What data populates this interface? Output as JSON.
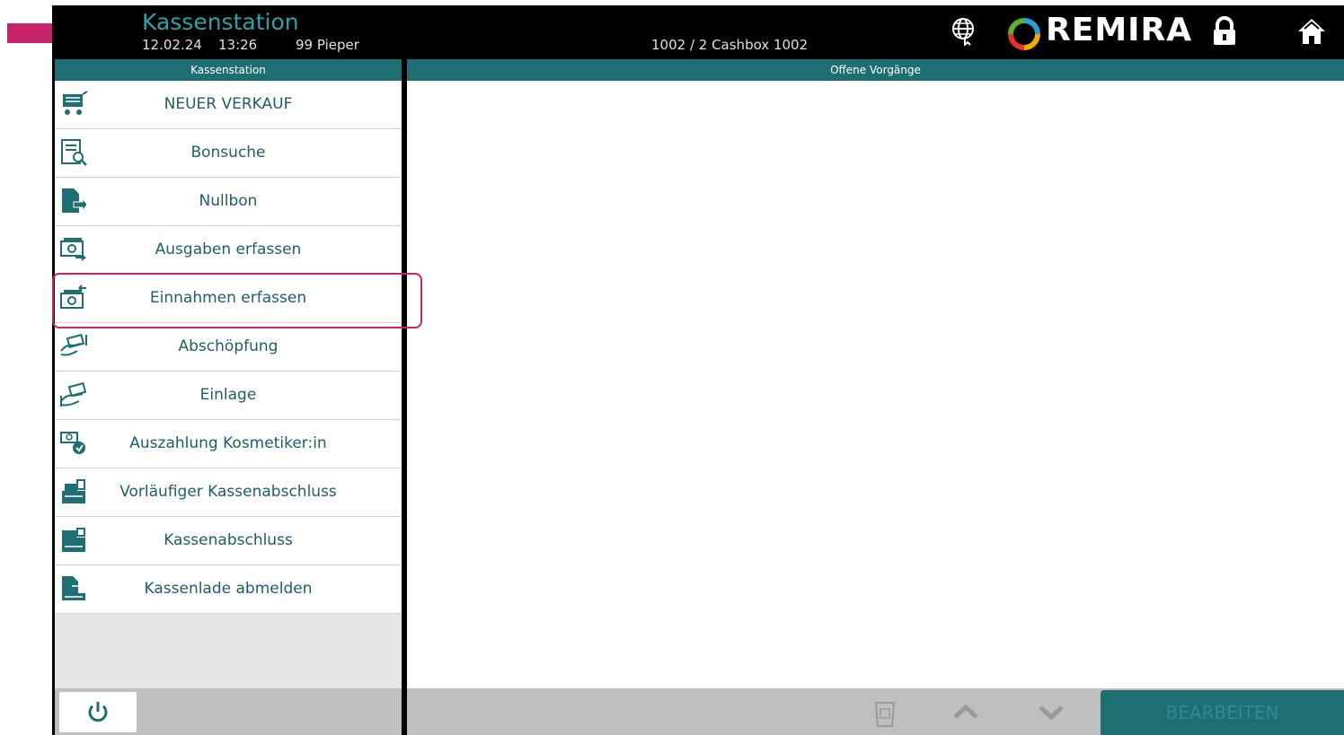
{
  "header": {
    "title": "Kassenstation",
    "date": "12.02.24",
    "time": "13:26",
    "user": "99 Pieper",
    "station": "1002 / 2 Cashbox 1002",
    "brand": "REMIRA",
    "icons": [
      "globe-icon",
      "remira-logo-icon",
      "lock-icon",
      "home-icon"
    ]
  },
  "left_panel": {
    "header": "Kassenstation",
    "items": [
      {
        "label": "NEUER VERKAUF",
        "icon": "cart-icon"
      },
      {
        "label": "Bonsuche",
        "icon": "receipt-search-icon"
      },
      {
        "label": "Nullbon",
        "icon": "document-arrow-icon"
      },
      {
        "label": "Ausgaben erfassen",
        "icon": "money-out-icon"
      },
      {
        "label": "Einnahmen erfassen",
        "icon": "money-in-icon"
      },
      {
        "label": "Abschöpfung",
        "icon": "hand-money-out-icon"
      },
      {
        "label": "Einlage",
        "icon": "hand-money-in-icon"
      },
      {
        "label": "Auszahlung Kosmetiker:in",
        "icon": "payout-icon"
      },
      {
        "label": "Vorläufiger Kassenabschluss",
        "icon": "register-close-preview-icon"
      },
      {
        "label": "Kassenabschluss",
        "icon": "register-close-icon"
      },
      {
        "label": "Kassenlade abmelden",
        "icon": "drawer-logout-icon"
      }
    ]
  },
  "right_panel": {
    "header": "Offene Vorgänge"
  },
  "bottom_bar": {
    "edit_label": "BEARBEITEN",
    "icons": [
      "power-icon",
      "delete-icon",
      "chevron-up-icon",
      "chevron-down-icon"
    ]
  },
  "colors": {
    "accent": "#1e6f73",
    "title": "#2aa3a8",
    "highlight": "#c8246c"
  }
}
